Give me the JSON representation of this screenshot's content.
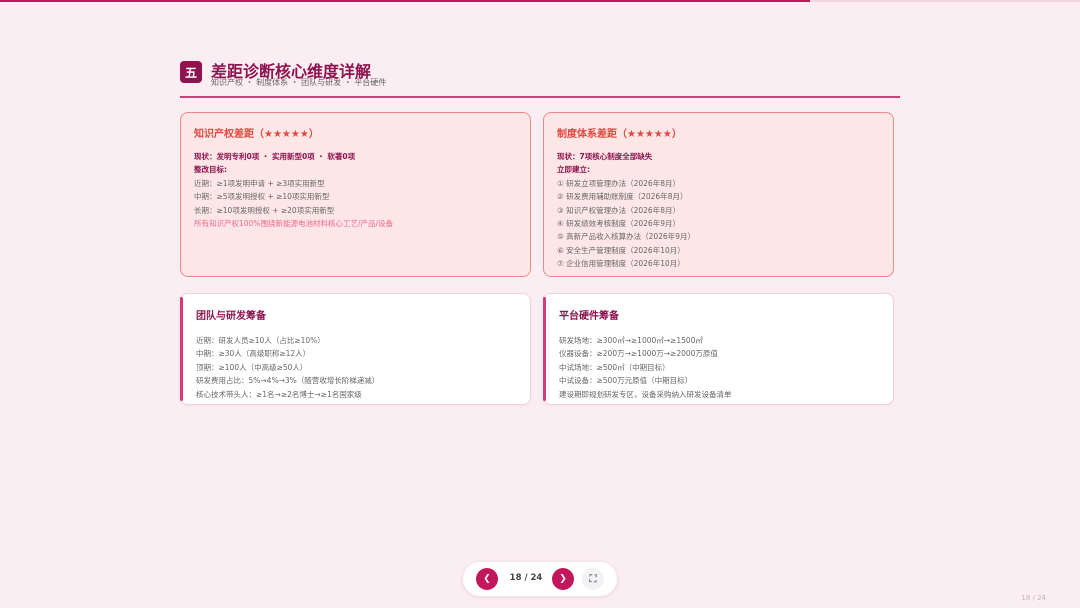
{
  "progress": {
    "fraction": 0.75
  },
  "header": {
    "section_number": "五",
    "title": "差距诊断核心维度详解",
    "subtitle": "知识产权 ・ 制度体系 ・ 团队与研发 ・ 平台硬件"
  },
  "cards": {
    "ip": {
      "title": "知识产权差距（★★★★★）",
      "status": "现状：发明专利0项 ・ 实用新型0项 ・ 软著0项",
      "target_heading": "整改目标:",
      "lines": [
        "近期：≥1项发明申请 + ≥3项实用新型",
        "中期：≥5项发明授权 + ≥10项实用新型",
        "长期：≥10项发明授权 + ≥20项实用新型"
      ],
      "note": "所有知识产权100%围绕新能源电池材料核心工艺/产品/设备"
    },
    "system": {
      "title": "制度体系差距（★★★★★）",
      "status": "现状：7项核心制度全部缺失",
      "target_heading": "立即建立:",
      "lines": [
        "① 研发立项管理办法（2026年8月）",
        "② 研发费用辅助账制度（2026年8月）",
        "③ 知识产权管理办法（2026年8月）",
        "④ 研发绩效考核制度（2026年9月）",
        "⑤ 高新产品收入核算办法（2026年9月）",
        "⑥ 安全生产管理制度（2026年10月）",
        "⑦ 企业信用管理制度（2026年10月）"
      ]
    },
    "team": {
      "title": "团队与研发筹备",
      "lines": [
        "近期：研发人员≥10人（占比≥10%）",
        "中期：≥30人（高级职称≥12人）",
        "顶期：≥100人（中高级≥50人）",
        "研发费用占比：5%→4%→3%（随营收增长阶梯递减）",
        "核心技术带头人：≥1名→≥2名博士→≥1名国家级"
      ]
    },
    "hardware": {
      "title": "平台硬件筹备",
      "lines": [
        "研发场地：≥300㎡→≥1000㎡→≥1500㎡",
        "仪器设备：≥200万→≥1000万→≥2000万原值",
        "中试场地：≥500㎡（中期目标）",
        "中试设备：≥500万元原值（中期目标）",
        "建设期即规划研发专区，设备采购纳入研发设备清单"
      ]
    }
  },
  "pager": {
    "prev_icon": "❮",
    "next_icon": "❯",
    "fullscreen_icon": "⛶",
    "count": "18 / 24"
  },
  "corner_page": "18 / 24",
  "colors": {
    "accent": "#c2185b",
    "title": "#8e1450",
    "gap_title": "#e2483f",
    "background": "#fbeef3"
  }
}
